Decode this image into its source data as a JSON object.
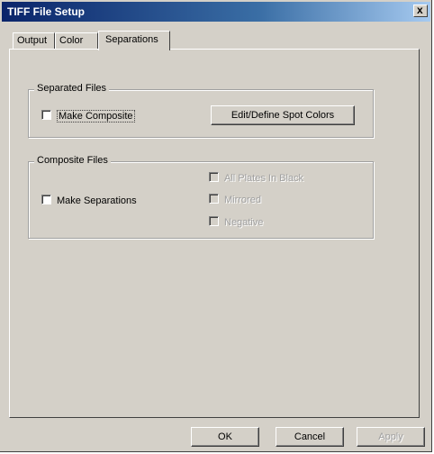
{
  "window": {
    "title": "TIFF File Setup",
    "close_label": "x"
  },
  "tabs": [
    {
      "label": "Output",
      "active": false
    },
    {
      "label": "Color",
      "active": false
    },
    {
      "label": "Separations",
      "active": true
    }
  ],
  "separated_files": {
    "legend": "Separated Files",
    "make_composite": {
      "label": "Make Composite",
      "checked": false
    },
    "spot_colors_button": "Edit/Define Spot Colors"
  },
  "composite_files": {
    "legend": "Composite Files",
    "make_separations": {
      "label": "Make Separations",
      "checked": false
    },
    "all_plates_in_black": {
      "label": "All Plates In Black",
      "checked": false,
      "enabled": false
    },
    "mirrored": {
      "label": "Mirrored",
      "checked": false,
      "enabled": false
    },
    "negative": {
      "label": "Negative",
      "checked": false,
      "enabled": false
    }
  },
  "footer": {
    "ok": "OK",
    "cancel": "Cancel",
    "apply": "Apply"
  }
}
